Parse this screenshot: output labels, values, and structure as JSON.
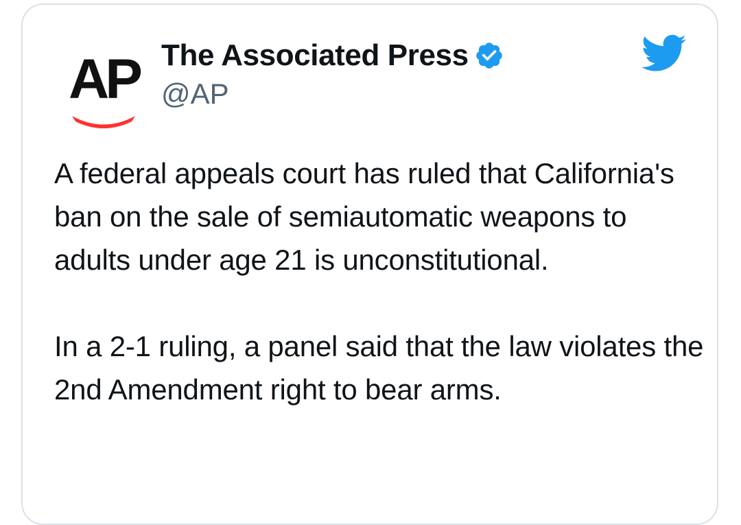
{
  "tweet": {
    "author": {
      "avatar_logo_text": "AP",
      "display_name": "The Associated Press",
      "handle": "@AP",
      "verified": true
    },
    "paragraphs": [
      "A federal appeals court has ruled that California's ban on the sale of semiautomatic weapons to adults under age 21 is unconstitutional.",
      "In a 2-1 ruling, a panel said that the law violates the 2nd Amendment right to bear arms."
    ]
  },
  "colors": {
    "verified_badge": "#1d9bf0",
    "twitter_brand": "#1d9bf0",
    "ap_red": "#ff322e",
    "text_primary": "#0f1419",
    "text_secondary": "#536471",
    "card_border": "#dbe0e4"
  },
  "icons": {
    "verified": "verified-badge-icon",
    "brand": "twitter-bird-icon"
  }
}
